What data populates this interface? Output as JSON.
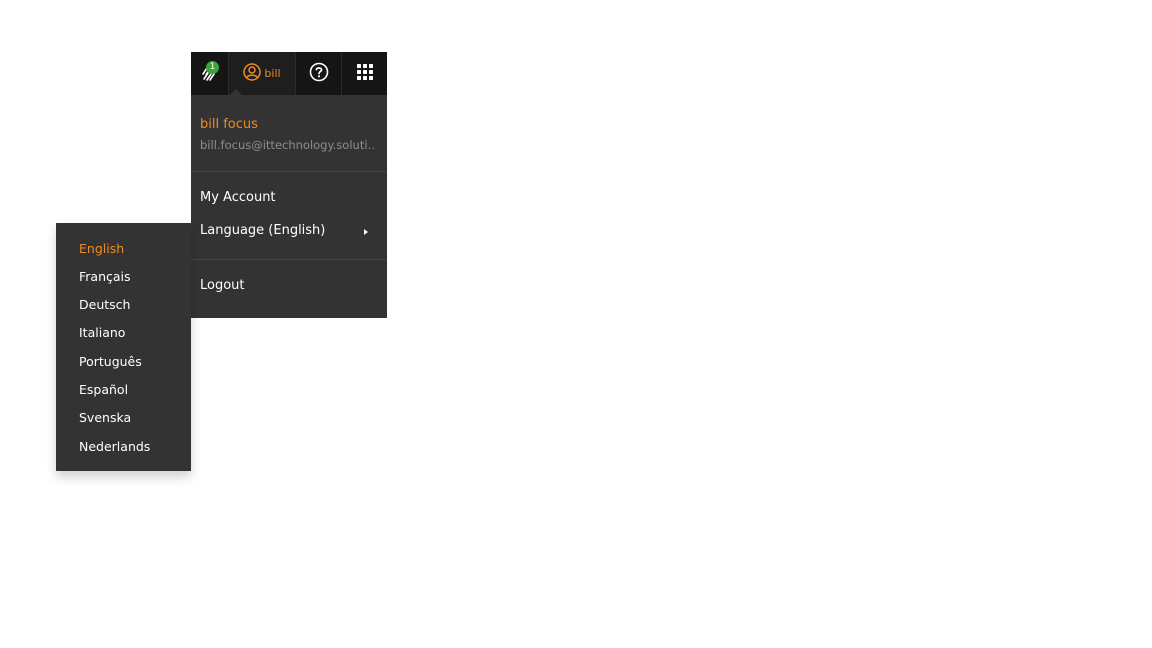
{
  "topbar": {
    "notification_count": "1",
    "user_label": "bill",
    "icons": [
      "activity-icon",
      "user-icon",
      "help-icon",
      "apps-grid-icon"
    ]
  },
  "user_menu": {
    "full_name": "bill focus",
    "email": "bill.focus@ittechnology.soluti…",
    "my_account": "My Account",
    "language": "Language (English)",
    "logout": "Logout"
  },
  "language_menu": {
    "selected": "English",
    "items": [
      "English",
      "Français",
      "Deutsch",
      "Italiano",
      "Português",
      "Español",
      "Svenska",
      "Nederlands"
    ]
  },
  "colors": {
    "accent": "#f08a24",
    "menu_bg": "#333333",
    "topbar_bg": "#151515",
    "badge": "#3aa63a"
  }
}
